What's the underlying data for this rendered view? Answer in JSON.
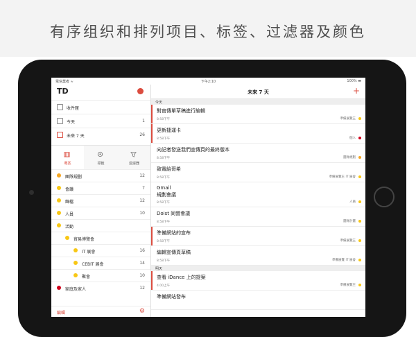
{
  "headline": "有序组织和排列项目、标签、过滤器及颜色",
  "status_bar": {
    "carrier": "電信業者 ≈",
    "time": "下午2:10",
    "battery": "100% ▬"
  },
  "colors": {
    "accent": "#db4c3f",
    "orange": "#f5a623",
    "yellow": "#f8c714",
    "red": "#d0021b"
  },
  "sidebar": {
    "nav": [
      {
        "label": "收件匣",
        "count": ""
      },
      {
        "label": "今天",
        "count": "1"
      },
      {
        "label": "未來 7 天",
        "count": "26"
      }
    ],
    "tabs": [
      {
        "label": "專案",
        "icon": "folder-icon"
      },
      {
        "label": "標籤",
        "icon": "tag-icon"
      },
      {
        "label": "過濾器",
        "icon": "filter-icon"
      }
    ],
    "projects": [
      {
        "label": "團隊規劃",
        "count": "12",
        "color": "#f5a623"
      },
      {
        "label": "會議",
        "count": "7",
        "color": "#f8c714"
      },
      {
        "label": "歸檔",
        "count": "12",
        "color": "#f8c714"
      },
      {
        "label": "人員",
        "count": "10",
        "color": "#f8c714"
      },
      {
        "label": "活動",
        "count": "",
        "color": "#f8c714"
      },
      {
        "label": "貿易博覽會",
        "count": "",
        "color": "#f8c714"
      },
      {
        "label": "IT 展會",
        "count": "16",
        "color": "#f8c714"
      },
      {
        "label": "CEBIT 展會",
        "count": "14",
        "color": "#f8c714"
      },
      {
        "label": "聚會",
        "count": "10",
        "color": "#f8c714"
      },
      {
        "label": "家庭及家人",
        "count": "12",
        "color": "#d0021b"
      }
    ],
    "footer_label": "編輯"
  },
  "main": {
    "title": "未來 7 天",
    "sections": [
      "今天",
      "明天"
    ],
    "today_tasks": [
      {
        "title": "對官傳單草稿進行編輯",
        "meta": "8:58下午",
        "project": "準備展覽王"
      },
      {
        "title": "更新捷運卡",
        "meta": "8:58下午",
        "project": "個人"
      },
      {
        "title": "向記者發送我們宣傳頁的最終版本",
        "meta": "8:58下午",
        "project": "團隊規劃"
      },
      {
        "title": "致電給哥希",
        "meta": "8:58下午",
        "project": "準備展覽王 IT 展會"
      },
      {
        "title": "Gmail",
        "title2": "規劃會議",
        "meta": "8:58下午",
        "project": "人員"
      },
      {
        "title": "Doist 同營會議",
        "meta": "8:58下午",
        "project": "團隊計畫"
      },
      {
        "title": "準備網站的宣布",
        "meta": "8:58下午",
        "project": "準備展覽王"
      },
      {
        "title": "編輯宣傳頁草稿",
        "meta": "8:58下午",
        "project": "準備展覽 IT 展會"
      }
    ],
    "tomorrow_tasks": [
      {
        "title": "查看 iDance 上的提案",
        "meta": "4.00上午",
        "project": "準備展覽王"
      },
      {
        "title": "準備網站發布",
        "meta": "",
        "project": ""
      }
    ]
  }
}
